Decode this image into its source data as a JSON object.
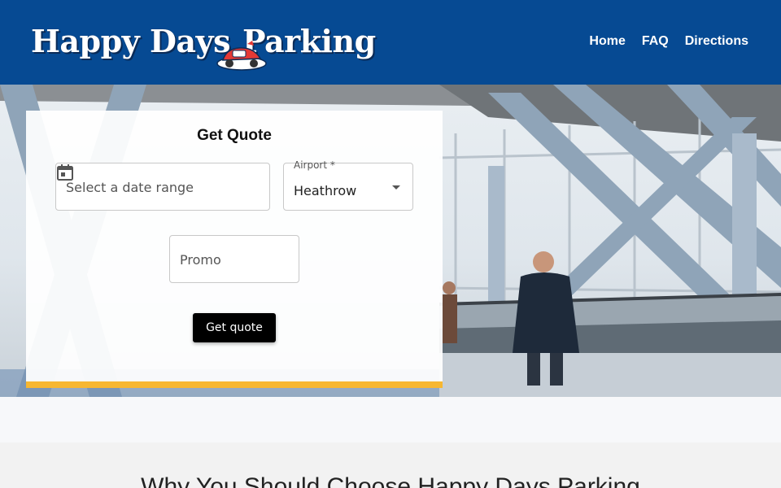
{
  "header": {
    "logo_word1": "Happy Days",
    "logo_word2": "Parking",
    "brand_color": "#064a93",
    "nav": [
      {
        "label": "Home"
      },
      {
        "label": "FAQ"
      },
      {
        "label": "Directions"
      }
    ]
  },
  "quote": {
    "title": "Get Quote",
    "date_placeholder": "Select a date range",
    "date_icon": "calendar-icon",
    "airport_label": "Airport *",
    "airport_value": "Heathrow",
    "promo_placeholder": "Promo",
    "button_label": "Get quote",
    "accent_color": "#f7b731"
  },
  "section": {
    "title": "Why You Should Choose Happy Days Parking"
  }
}
